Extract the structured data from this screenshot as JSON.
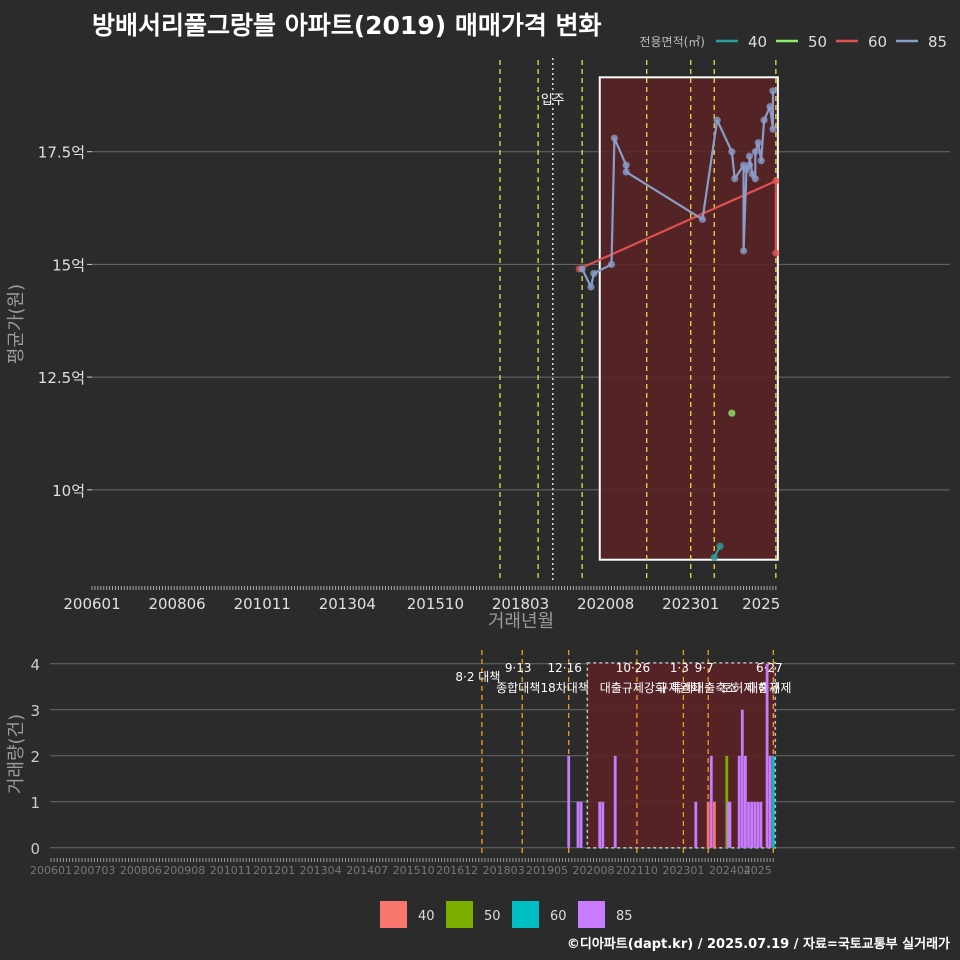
{
  "title": "방배서리풀그랑블 아파트(2019) 매매가격 변화",
  "footer": "©디아파트(dapt.kr) / 2025.07.19 / 자료=국토교통부 실거래가",
  "colors": {
    "background": "#2b2b2b",
    "grid": "#6b6b6b",
    "policy_line": "#e8e04a",
    "policy_line_bottom": "#f0a020",
    "move_in_line": "#dddddd",
    "highlight_fill": "#5a2225",
    "line_40": "#2a9d9d",
    "line_50": "#90ee6a",
    "line_60": "#e05050",
    "line_85": "#8a9cc8",
    "bar_40": "#f8766d",
    "bar_50": "#7cae00",
    "bar_60": "#00bfc4",
    "bar_85": "#c77cff"
  },
  "chart_data": [
    {
      "type": "line",
      "title": "방배서리풀그랑블 아파트(2019) 매매가격 변화",
      "xlabel": "거래년월",
      "ylabel": "평균가(원)",
      "x_ticks": [
        "200601",
        "200806",
        "201011",
        "201304",
        "201510",
        "201803",
        "202008",
        "202301",
        "2025"
      ],
      "y_ticks": [
        {
          "value": 10,
          "label": "10억"
        },
        {
          "value": 12.5,
          "label": "12.5억"
        },
        {
          "value": 15,
          "label": "15억"
        },
        {
          "value": 17.5,
          "label": "17.5억"
        }
      ],
      "ylim": [
        8.0,
        19.8
      ],
      "legend_title": "전용면적(㎡)",
      "legend_position": "top-right",
      "annotation": "입주",
      "move_in_date": "2019-02",
      "policy_dates": [
        "2017-08",
        "2018-09",
        "2019-12",
        "2021-10",
        "2023-01",
        "2023-09",
        "2025-06"
      ],
      "highlight_range": {
        "x": [
          "2020-06",
          "2025-06"
        ],
        "y": [
          8.45,
          19.15
        ]
      },
      "series": [
        {
          "name": "40",
          "points": [
            [
              "2023-09",
              8.5
            ],
            [
              "2023-11",
              8.75
            ]
          ]
        },
        {
          "name": "50",
          "points": [
            [
              "2024-03",
              11.7
            ]
          ]
        },
        {
          "name": "60",
          "points": [
            [
              "2019-11",
              14.9
            ],
            [
              "2025-06",
              16.85
            ],
            [
              "2025-06",
              15.25
            ]
          ]
        },
        {
          "name": "85",
          "points": [
            [
              "2019-12",
              14.9
            ],
            [
              "2020-03",
              14.5
            ],
            [
              "2020-04",
              14.8
            ],
            [
              "2020-10",
              15.0
            ],
            [
              "2020-11",
              17.8
            ],
            [
              "2021-03",
              17.2
            ],
            [
              "2021-03",
              17.05
            ],
            [
              "2023-05",
              16.0
            ],
            [
              "2023-10",
              18.2
            ],
            [
              "2024-03",
              17.5
            ],
            [
              "2024-04",
              16.9
            ],
            [
              "2024-07",
              17.2
            ],
            [
              "2024-07",
              15.3
            ],
            [
              "2024-08",
              17.1
            ],
            [
              "2024-09",
              17.2
            ],
            [
              "2024-09",
              17.4
            ],
            [
              "2024-10",
              17.0
            ],
            [
              "2024-11",
              16.9
            ],
            [
              "2024-11",
              17.5
            ],
            [
              "2024-12",
              17.7
            ],
            [
              "2025-01",
              17.3
            ],
            [
              "2025-02",
              18.2
            ],
            [
              "2025-04",
              18.5
            ],
            [
              "2025-05",
              18.0
            ],
            [
              "2025-05",
              18.85
            ]
          ]
        }
      ]
    },
    {
      "type": "bar",
      "xlabel": "",
      "ylabel": "거래량(건)",
      "x_ticks": [
        "200601",
        "200703",
        "200806",
        "200908",
        "201011",
        "201201",
        "201304",
        "201407",
        "201510",
        "201612",
        "201803",
        "201905",
        "202008",
        "202110",
        "202301",
        "202404",
        "2025"
      ],
      "y_ticks": [
        0,
        1,
        2,
        3,
        4
      ],
      "ylim": [
        -0.2,
        4.3
      ],
      "legend_position": "bottom",
      "legend": [
        "40",
        "50",
        "60",
        "85"
      ],
      "highlight_range": {
        "x": [
          "2020-06",
          "2025-06"
        ]
      },
      "policies": [
        {
          "date": "2017-08",
          "line1": "8·2 대책",
          "line2": ""
        },
        {
          "date": "2018-09",
          "line1": "9·13",
          "line2": "종합대책"
        },
        {
          "date": "2019-12",
          "line1": "12·16",
          "line2": "18차대책"
        },
        {
          "date": "2021-10",
          "line1": "10·26",
          "line2": "대출규제강화"
        },
        {
          "date": "2023-01",
          "line1": "1·3",
          "line2": "규제완화"
        },
        {
          "date": "2023-09",
          "line1": "9·7",
          "line2": "특례대출축소"
        },
        {
          "date": "2024-12",
          "line1": "",
          "line2": "토허제 해제"
        },
        {
          "date": "2025-06",
          "line1": "6·27",
          "line2": "대출규제"
        }
      ],
      "bars": [
        {
          "date": "2019-12",
          "series": "85",
          "value": 2
        },
        {
          "date": "2020-03",
          "series": "85",
          "value": 1
        },
        {
          "date": "2020-04",
          "series": "85",
          "value": 1
        },
        {
          "date": "2020-10",
          "series": "85",
          "value": 1
        },
        {
          "date": "2020-11",
          "series": "85",
          "value": 1
        },
        {
          "date": "2021-03",
          "series": "85",
          "value": 2
        },
        {
          "date": "2023-05",
          "series": "85",
          "value": 1
        },
        {
          "date": "2023-09",
          "series": "40",
          "value": 1
        },
        {
          "date": "2023-10",
          "series": "85",
          "value": 2
        },
        {
          "date": "2023-11",
          "series": "40",
          "value": 1
        },
        {
          "date": "2024-03",
          "series": "50",
          "value": 2
        },
        {
          "date": "2024-03",
          "series": "85",
          "value": 1
        },
        {
          "date": "2024-04",
          "series": "85",
          "value": 1
        },
        {
          "date": "2024-07",
          "series": "85",
          "value": 2
        },
        {
          "date": "2024-08",
          "series": "85",
          "value": 3
        },
        {
          "date": "2024-09",
          "series": "85",
          "value": 2
        },
        {
          "date": "2024-10",
          "series": "85",
          "value": 1
        },
        {
          "date": "2024-11",
          "series": "85",
          "value": 1
        },
        {
          "date": "2024-12",
          "series": "85",
          "value": 1
        },
        {
          "date": "2025-01",
          "series": "85",
          "value": 1
        },
        {
          "date": "2025-02",
          "series": "85",
          "value": 1
        },
        {
          "date": "2025-04",
          "series": "85",
          "value": 4
        },
        {
          "date": "2025-05",
          "series": "85",
          "value": 2
        },
        {
          "date": "2025-06",
          "series": "60",
          "value": 2
        }
      ]
    }
  ]
}
